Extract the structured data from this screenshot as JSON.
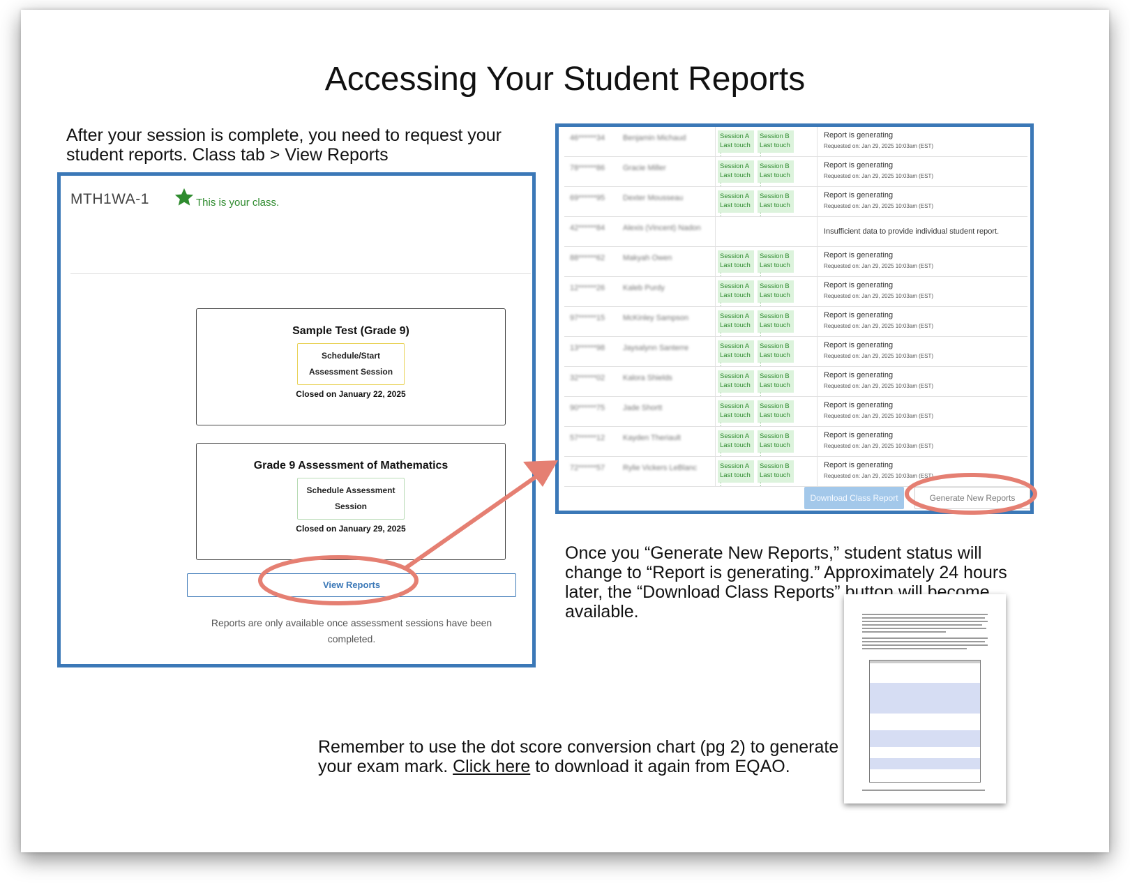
{
  "title": "Accessing Your Student Reports",
  "intro": {
    "line1": "After your session is complete, you need to request your",
    "line2": "student reports.  Class tab > View Reports"
  },
  "class_panel": {
    "class_code": "MTH1WA-1",
    "status": "This is your class.",
    "cards": [
      {
        "title": "Sample Test (Grade 9)",
        "button_line1": "Schedule/Start",
        "button_line2": "Assessment Session",
        "closed": "Closed on January 22, 2025"
      },
      {
        "title": "Grade 9 Assessment of Mathematics",
        "button_line1": "Schedule Assessment",
        "button_line2": "Session",
        "closed": "Closed on January 29, 2025"
      }
    ],
    "view_reports": "View Reports",
    "note": "Reports are only available once assessment sessions have been completed."
  },
  "reports_panel": {
    "session_a": "Session A",
    "session_b": "Session B",
    "last_touch": "Last touch :",
    "status_generating": "Report is generating",
    "requested": "Requested on: Jan 29, 2025 10:03am (EST)",
    "status_insufficient": "Insufficient data to provide individual student report.",
    "rows": [
      {
        "id": "46******34",
        "name": "Benjamin Michaud"
      },
      {
        "id": "78******86",
        "name": "Gracie Miller"
      },
      {
        "id": "69******95",
        "name": "Dexter Mousseau"
      },
      {
        "id": "42******84",
        "name": "Alexis (Vincent) Nadon",
        "insufficient": true
      },
      {
        "id": "88******62",
        "name": "Makyah Owen"
      },
      {
        "id": "12******26",
        "name": "Kaleb Purdy"
      },
      {
        "id": "97******15",
        "name": "McKinley Sampson"
      },
      {
        "id": "13******98",
        "name": "Jaysalynn Santerre"
      },
      {
        "id": "32******02",
        "name": "Kalora Shields"
      },
      {
        "id": "90******75",
        "name": "Jade Shortt"
      },
      {
        "id": "57******12",
        "name": "Kayden Theriault"
      },
      {
        "id": "72******57",
        "name": "Rylie Vickers LeBlanc"
      }
    ],
    "download_button": "Download Class Report",
    "generate_button": "Generate New Reports"
  },
  "notice": {
    "line1": "Once you “Generate New Reports,” student status will",
    "line2": "change to “Report is generating.”  Approximately 24 hours",
    "line3": "later, the “Download Class Reports” button will become",
    "line4": "available."
  },
  "reminder": {
    "line1": "Remember to use the dot score conversion chart (pg 2) to generate",
    "line2_before": "your exam mark.  ",
    "link": "Click here",
    "line2_after": " to download it again from EQAO."
  },
  "colors": {
    "panel_border": "#3b78b7",
    "annotation": "#e57f72",
    "session_green": "#dcf3dc",
    "status_green": "#2e8b2e"
  },
  "icons": [
    "star-icon",
    "arrow-icon"
  ]
}
